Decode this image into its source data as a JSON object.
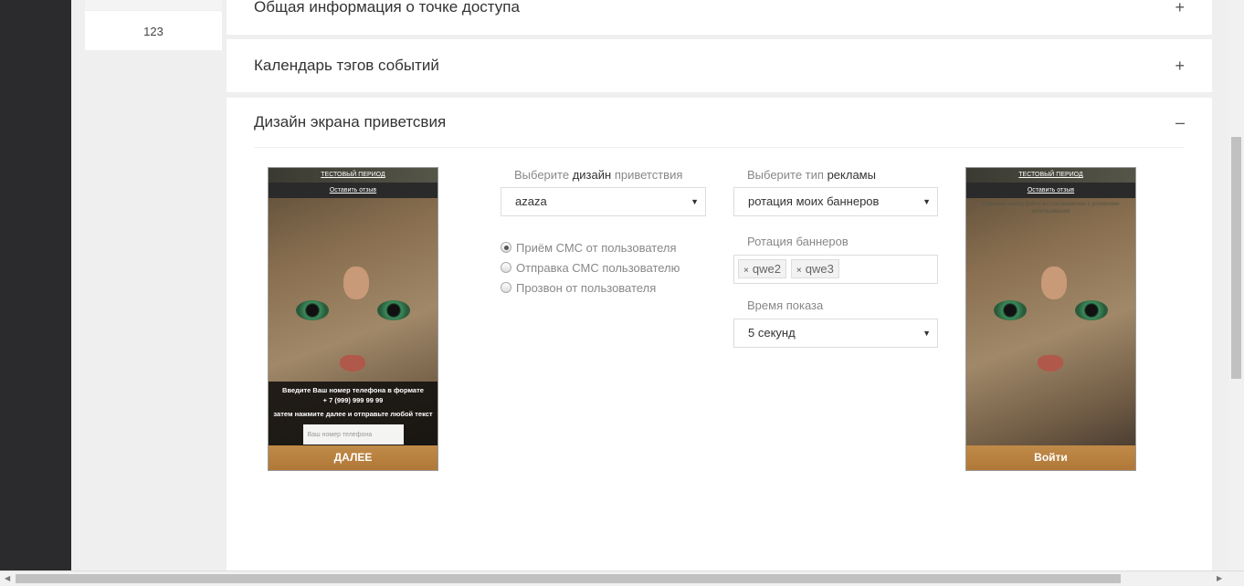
{
  "sidebar": {
    "counter": "123"
  },
  "sections": [
    {
      "title": "Общая информация о точке доступа",
      "toggle": "+"
    },
    {
      "title": "Календарь тэгов событий",
      "toggle": "+"
    },
    {
      "title": "Дизайн экрана приветсвия",
      "toggle": "–"
    }
  ],
  "design": {
    "design_label_1": "Выберите",
    "design_label_2": "дизайн",
    "design_label_3": "приветствия",
    "design_value": "azaza",
    "radios": [
      {
        "label": "Приём СМС от пользователя",
        "checked": true
      },
      {
        "label": "Отправка СМС пользователю",
        "checked": false
      },
      {
        "label": "Прозвон от пользователя",
        "checked": false
      }
    ],
    "ad_label_1": "Выберите тип",
    "ad_label_2": "рекламы",
    "ad_value": "ротация моих баннеров",
    "rotation_label": "Ротация баннеров",
    "tags": [
      "qwe2",
      "qwe3"
    ],
    "tag_remove": "×",
    "time_label": "Время показа",
    "time_value": "5 секунд",
    "arrow": "▼"
  },
  "preview_left": {
    "top": "ТЕСТОВЫЙ ПЕРИОД",
    "feedback": "Оставить отзыв",
    "line1": "Введите Ваш номер телефона в формате",
    "line2": "+ 7 (999) 999 99 99",
    "line3": "затем нажмите далее и отправьте любой текст",
    "input_placeholder": "Ваш номер телефона",
    "button": "ДАЛЕЕ"
  },
  "preview_right": {
    "top": "ТЕСТОВЫЙ ПЕРИОД",
    "feedback": "Оставить отзыв",
    "note": "Нажимая кнопку Войти вы соглашаетесь с условиями использования",
    "button": "Войти"
  }
}
